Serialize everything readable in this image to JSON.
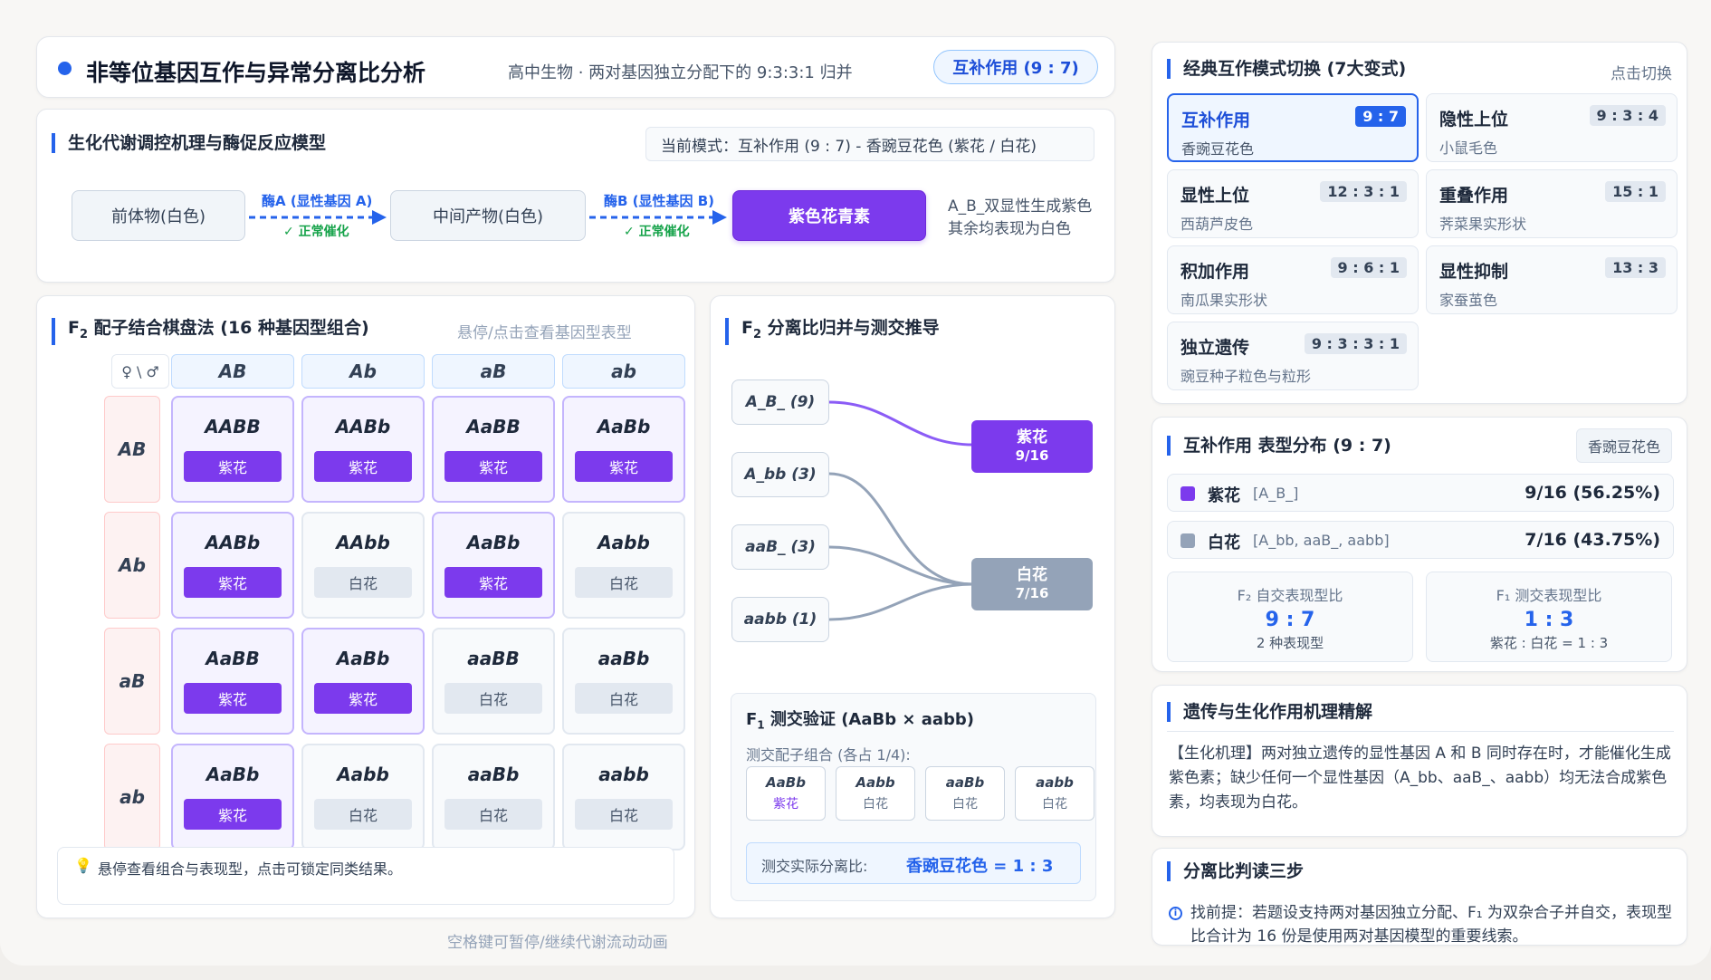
{
  "header": {
    "title": "非等位基因互作与异常分离比分析",
    "subtitle": "高中生物 · 两对基因独立分配下的 9:3:3:1 归并",
    "badge": "互补作用 (9 : 7)"
  },
  "pathway": {
    "title": "生化代谢调控机理与酶促反应模型",
    "current_mode": "当前模式：互补作用 (9 : 7) - 香豌豆花色 (紫花 / 白花)",
    "node1": "前体物(白色)",
    "node2": "中间产物(白色)",
    "node3": "紫色花青素",
    "enzyme_a": "酶A (显性基因 A)",
    "enzyme_b": "酶B (显性基因 B)",
    "ok_a": "✓ 正常催化",
    "ok_b": "✓ 正常催化",
    "note_line1": "A_B_双显性生成紫色",
    "note_line2": "其余均表现为白色"
  },
  "punnett": {
    "title_pre": "F",
    "title_sub": "2",
    "title_post": " 配子结合棋盘法 (16 种基因型组合)",
    "hint": "悬停/点击查看基因型表型",
    "corner": "♀ \\ ♂",
    "cols": [
      "AB",
      "Ab",
      "aB",
      "ab"
    ],
    "rows": [
      {
        "label": "AB",
        "cells": [
          {
            "g": "AABB",
            "p": "紫花",
            "purple": true
          },
          {
            "g": "AABb",
            "p": "紫花",
            "purple": true
          },
          {
            "g": "AaBB",
            "p": "紫花",
            "purple": true
          },
          {
            "g": "AaBb",
            "p": "紫花",
            "purple": true
          }
        ]
      },
      {
        "label": "Ab",
        "cells": [
          {
            "g": "AABb",
            "p": "紫花",
            "purple": true
          },
          {
            "g": "AAbb",
            "p": "白花",
            "purple": false
          },
          {
            "g": "AaBb",
            "p": "紫花",
            "purple": true
          },
          {
            "g": "Aabb",
            "p": "白花",
            "purple": false
          }
        ]
      },
      {
        "label": "aB",
        "cells": [
          {
            "g": "AaBB",
            "p": "紫花",
            "purple": true
          },
          {
            "g": "AaBb",
            "p": "紫花",
            "purple": true
          },
          {
            "g": "aaBB",
            "p": "白花",
            "purple": false
          },
          {
            "g": "aaBb",
            "p": "白花",
            "purple": false
          }
        ]
      },
      {
        "label": "ab",
        "cells": [
          {
            "g": "AaBb",
            "p": "紫花",
            "purple": true
          },
          {
            "g": "Aabb",
            "p": "白花",
            "purple": false
          },
          {
            "g": "aaBb",
            "p": "白花",
            "purple": false
          },
          {
            "g": "aabb",
            "p": "白花",
            "purple": false
          }
        ]
      }
    ],
    "tip": "悬停查看组合与表现型，点击可锁定同类结果。",
    "footer_hint": "空格键可暂停/继续代谢流动动画"
  },
  "segregation": {
    "title_pre": "F",
    "title_sub": "2",
    "title_post": " 分离比归并与测交推导",
    "genotypes": [
      "A_B_ (9)",
      "A_bb (3)",
      "aaB_ (3)",
      "aabb (1)"
    ],
    "purple_name": "紫花",
    "purple_ratio": "9/16",
    "white_name": "白花",
    "white_ratio": "7/16",
    "testcross": {
      "title_pre": "F",
      "title_sub": "1",
      "title_post": " 测交验证 (AaBb × aabb)",
      "subtitle": "测交配子组合 (各占 1/4):",
      "cells": [
        {
          "g": "AaBb",
          "p": "紫花"
        },
        {
          "g": "Aabb",
          "p": "白花"
        },
        {
          "g": "aaBb",
          "p": "白花"
        },
        {
          "g": "aabb",
          "p": "白花"
        }
      ],
      "result_label": "测交实际分离比:",
      "result_value": "香豌豆花色 = 1 : 3"
    }
  },
  "modes": {
    "title": "经典互作模式切换 (7大变式)",
    "action": "点击切换",
    "items": [
      {
        "name": "互补作用",
        "ratio": "9 : 7",
        "desc": "香豌豆花色",
        "active": true
      },
      {
        "name": "隐性上位",
        "ratio": "9 : 3 : 4",
        "desc": "小鼠毛色",
        "active": false
      },
      {
        "name": "显性上位",
        "ratio": "12 : 3 : 1",
        "desc": "西葫芦皮色",
        "active": false
      },
      {
        "name": "重叠作用",
        "ratio": "15 : 1",
        "desc": "荠菜果实形状",
        "active": false
      },
      {
        "name": "积加作用",
        "ratio": "9 : 6 : 1",
        "desc": "南瓜果实形状",
        "active": false
      },
      {
        "name": "显性抑制",
        "ratio": "13 : 3",
        "desc": "家蚕茧色",
        "active": false
      },
      {
        "name": "独立遗传",
        "ratio": "9 : 3 : 3 : 1",
        "desc": "豌豆种子粒色与粒形",
        "active": false
      }
    ]
  },
  "distribution": {
    "title": "互补作用 表型分布 (9 : 7)",
    "badge": "香豌豆花色",
    "rows": [
      {
        "name": "紫花",
        "genotype": "[A_B_]",
        "value": "9/16 (56.25%)",
        "color": "#7c3aed"
      },
      {
        "name": "白花",
        "genotype": "[A_bb, aaB_, aabb]",
        "value": "7/16 (43.75%)",
        "color": "#94a3b8"
      }
    ],
    "stat1": {
      "title": "F₂ 自交表现型比",
      "value": "9 : 7",
      "sub": "2 种表现型"
    },
    "stat2": {
      "title": "F₁ 测交表现型比",
      "value": "1 : 3",
      "sub": "紫花 : 白花 = 1 : 3"
    }
  },
  "mechanism": {
    "title": "遗传与生化作用机理精解",
    "text": "【生化机理】两对独立遗传的显性基因 A 和 B 同时存在时，才能催化生成紫色素；缺少任何一个显性基因（A_bb、aaB_、aabb）均无法合成紫色素，均表现为白花。"
  },
  "steps": {
    "title": "分离比判读三步",
    "step1": "找前提：若题设支持两对基因独立分配、F₁ 为双杂合子并自交，表现型比合计为 16 份是使用两对基因模型的重要线索。"
  },
  "colors": {
    "accent": "#2563eb",
    "purple": "#7c3aed",
    "white_pheno": "#94a3b8"
  }
}
